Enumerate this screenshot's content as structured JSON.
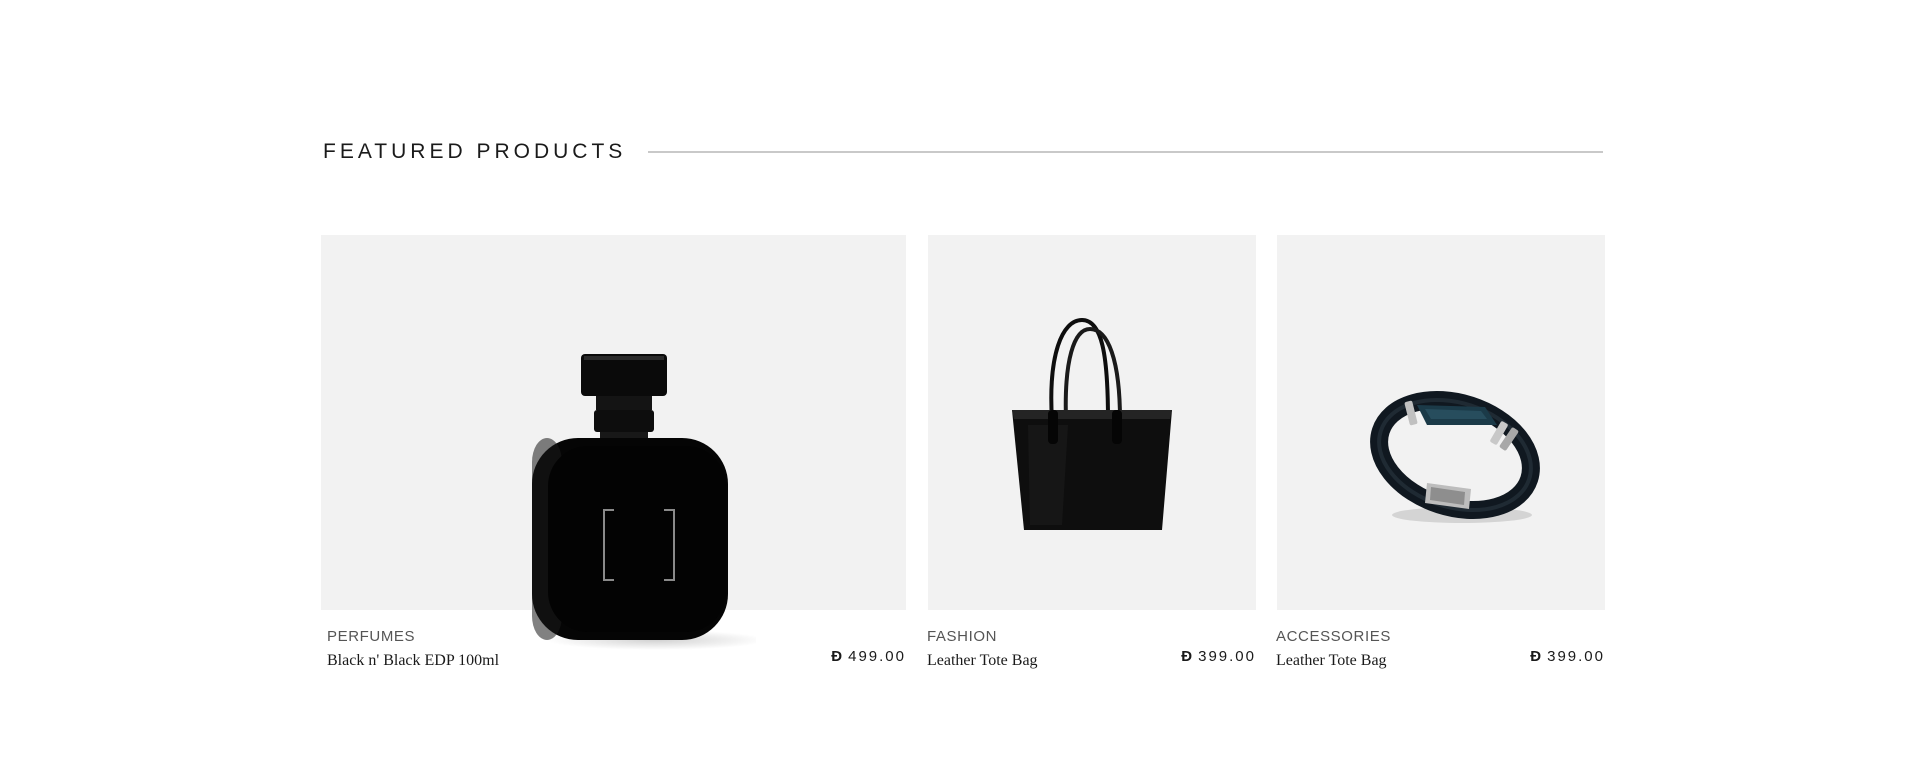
{
  "section": {
    "title": "FEATURED PRODUCTS"
  },
  "products": [
    {
      "category": "PERFUMES",
      "name": "Black n' Black EDP 100ml",
      "currency": "Đ",
      "price": "499.00",
      "image_icon": "perfume-bottle-icon"
    },
    {
      "category": "FASHION",
      "name": "Leather Tote Bag",
      "currency": "Đ",
      "price": "399.00",
      "image_icon": "tote-bag-icon"
    },
    {
      "category": "ACCESSORIES",
      "name": "Leather Tote Bag",
      "currency": "Đ",
      "price": "399.00",
      "image_icon": "bracelet-icon"
    }
  ],
  "colors": {
    "background": "#ffffff",
    "card_background": "#f2f2f2",
    "rule": "#c9c9c9",
    "text": "#1a1a1a",
    "muted": "#555555"
  }
}
